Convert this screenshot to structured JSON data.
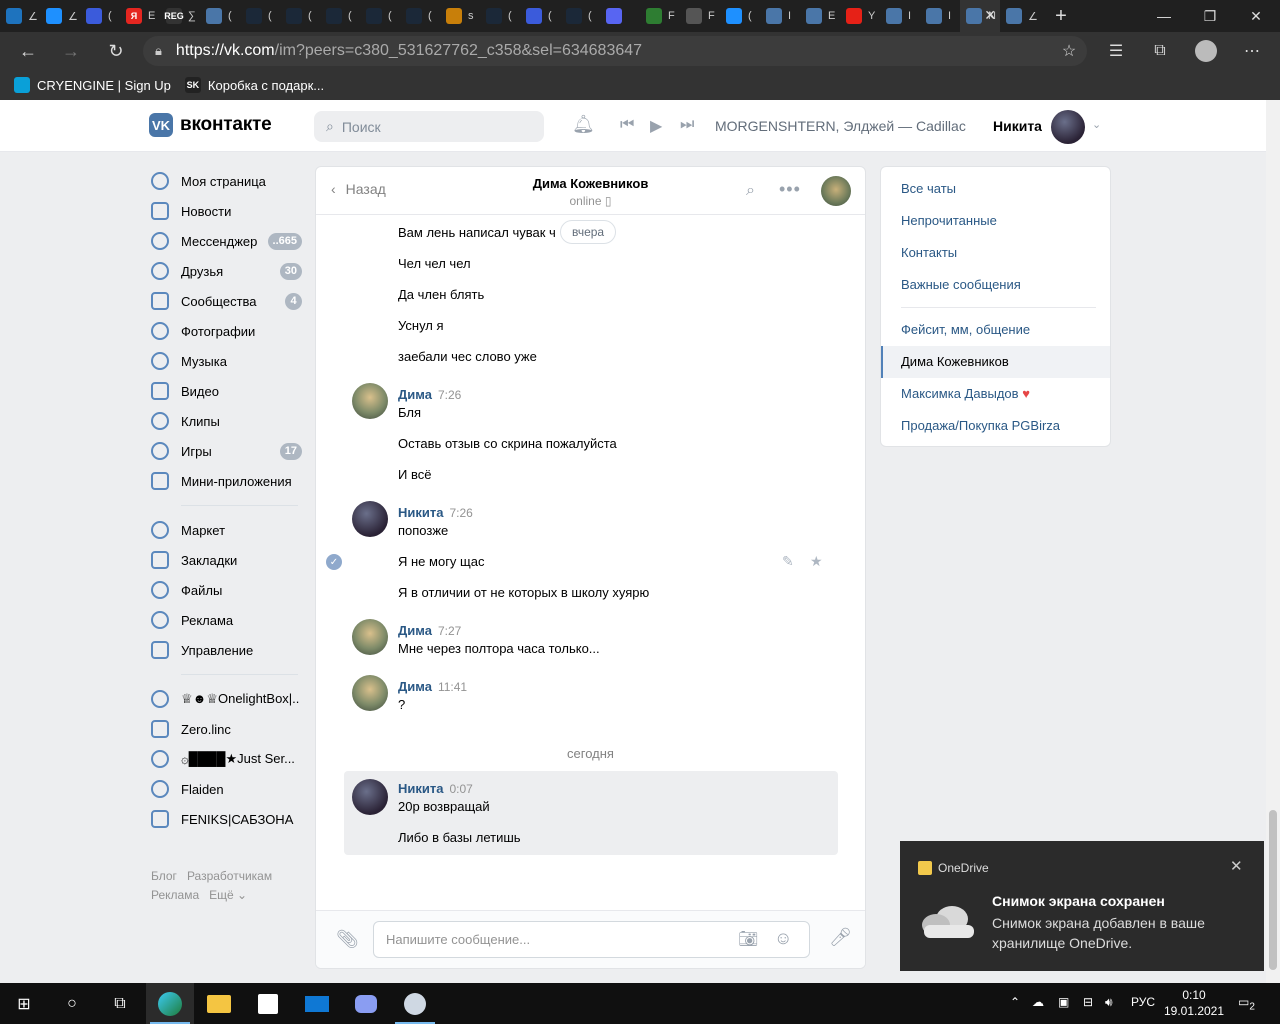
{
  "browser": {
    "tabs": [
      {
        "letter": "",
        "color": "#1e73be",
        "icon": "feather-icon"
      },
      {
        "letter": "",
        "color": "#1e90ff",
        "icon": "chat-icon"
      },
      {
        "letter": "",
        "color": "#3b5bdb",
        "icon": "hex-icon"
      },
      {
        "letter": "Я",
        "color": "#e52620",
        "icon": "yandex-icon"
      },
      {
        "letter": "REG",
        "color": "#333333",
        "icon": "reg-icon"
      },
      {
        "letter": "",
        "color": "#4a76a8",
        "icon": "vk-icon"
      },
      {
        "letter": "",
        "color": "#1b2838",
        "icon": "steam-icon"
      },
      {
        "letter": "",
        "color": "#1b2838",
        "icon": "steam-icon"
      },
      {
        "letter": "",
        "color": "#1b2838",
        "icon": "steam-icon"
      },
      {
        "letter": "",
        "color": "#1b2838",
        "icon": "steam-icon"
      },
      {
        "letter": "",
        "color": "#1b2838",
        "icon": "steam-icon"
      },
      {
        "letter": "",
        "color": "#c87f0a",
        "icon": "coin-icon"
      },
      {
        "letter": "",
        "color": "#1b2838",
        "icon": "steam-icon"
      },
      {
        "letter": "",
        "color": "#3b5bdb",
        "icon": "cat-icon"
      },
      {
        "letter": "",
        "color": "#1b2838",
        "icon": "steam-icon"
      },
      {
        "letter": "",
        "color": "#5865f2",
        "icon": "discord-icon"
      },
      {
        "letter": "",
        "color": "#2e7d32",
        "icon": "chart-icon"
      },
      {
        "letter": "",
        "color": "#555555",
        "icon": "grid-icon"
      },
      {
        "letter": "",
        "color": "#1e90ff",
        "icon": "chat-icon"
      },
      {
        "letter": "",
        "color": "#4a76a8",
        "icon": "vk-icon"
      },
      {
        "letter": "",
        "color": "#4a76a8",
        "icon": "vk-icon"
      },
      {
        "letter": "",
        "color": "#e62117",
        "icon": "youtube-icon"
      },
      {
        "letter": "",
        "color": "#4a76a8",
        "icon": "vk-icon"
      },
      {
        "letter": "",
        "color": "#4a76a8",
        "icon": "vk-icon"
      },
      {
        "letter": "",
        "color": "#4a76a8",
        "icon": "vk-icon"
      },
      {
        "letter": "",
        "color": "#4a76a8",
        "icon": "vk-icon"
      }
    ],
    "tab_titles": [
      "∠",
      "∠",
      "(",
      "E",
      "∑",
      "(",
      "(",
      "(",
      "(",
      "(",
      "(",
      "s",
      "(",
      "(",
      "(",
      "",
      "F",
      "F",
      "(",
      "I",
      "E",
      "Y",
      "I",
      "I",
      "Ν",
      "∠"
    ],
    "url_host": "https://vk.com",
    "url_path": "/im?peers=c380_531627762_c358&sel=634683647",
    "bookmarks": [
      {
        "label": "CRYENGINE | Sign Up",
        "color": "#0aa0d8",
        "icon": "cryengine-icon"
      },
      {
        "label": "Коробка с подарк...",
        "color": "#222222",
        "icon": "sk-icon",
        "letter": "SK"
      }
    ]
  },
  "vk": {
    "logo_text": "вконтакте",
    "search_placeholder": "Поиск",
    "track": "MORGENSHTERN, Элджей — Cadillac",
    "user_name": "Никита",
    "nav": [
      {
        "label": "Моя страница",
        "icon": "user-circle-icon"
      },
      {
        "label": "Новости",
        "icon": "news-icon"
      },
      {
        "label": "Мессенджер",
        "icon": "message-icon",
        "badge": "..665"
      },
      {
        "label": "Друзья",
        "icon": "friends-icon",
        "badge": "30"
      },
      {
        "label": "Сообщества",
        "icon": "groups-icon",
        "badge": "4"
      },
      {
        "label": "Фотографии",
        "icon": "photo-icon"
      },
      {
        "label": "Музыка",
        "icon": "music-icon"
      },
      {
        "label": "Видео",
        "icon": "video-icon"
      },
      {
        "label": "Клипы",
        "icon": "clips-icon"
      },
      {
        "label": "Игры",
        "icon": "games-icon",
        "badge": "17"
      },
      {
        "label": "Мини-приложения",
        "icon": "apps-icon"
      }
    ],
    "nav2": [
      {
        "label": "Маркет",
        "icon": "market-icon"
      },
      {
        "label": "Закладки",
        "icon": "star-icon"
      },
      {
        "label": "Файлы",
        "icon": "file-icon"
      },
      {
        "label": "Реклама",
        "icon": "ads-icon"
      },
      {
        "label": "Управление",
        "icon": "manage-icon"
      }
    ],
    "groups": [
      {
        "label": "♕☻♕OnelightBox|..",
        "icon": "group-icon"
      },
      {
        "label": "Zero.linc",
        "icon": "group-icon"
      },
      {
        "label": "۞████★Just Ser...",
        "icon": "group-icon"
      },
      {
        "label": "Flaiden",
        "icon": "group-icon"
      },
      {
        "label": "FENIKS|САБЗОНА",
        "icon": "group-icon"
      }
    ],
    "footer": {
      "blog": "Блог",
      "dev": "Разработчикам",
      "ads": "Реклама",
      "more": "Ещё ⌄"
    }
  },
  "chat": {
    "back_label": "Назад",
    "name": "Дима Кожевников",
    "status": "online",
    "day_pill": "вчера",
    "today": "сегодня",
    "input_placeholder": "Напишите сообщение...",
    "messages": [
      {
        "text": "Вам лень написал чувак ч"
      },
      {
        "text": "Чел чел чел"
      },
      {
        "text": "Да член блять"
      },
      {
        "text": "Уснул я"
      },
      {
        "text": "заебали чес слово уже"
      },
      {
        "author": "Дима",
        "time": "7:26",
        "text": "Бля"
      },
      {
        "text": "Оставь отзыв со скрина пожалуйста"
      },
      {
        "text": "И всё"
      },
      {
        "author": "Никита",
        "time": "7:26",
        "text": "попозже"
      },
      {
        "text": "Я не могу щас"
      },
      {
        "text": "Я в отличии от не которых в школу хуярю"
      },
      {
        "author": "Дима",
        "time": "7:27",
        "text": "Мне через полтора часа только..."
      },
      {
        "author": "Дима",
        "time": "11:41",
        "text": "?"
      },
      {
        "author": "Никита",
        "time": "0:07",
        "text": "20р возвращай"
      },
      {
        "text": "Либо в базы летишь"
      }
    ]
  },
  "right_menu": {
    "items": [
      "Все чаты",
      "Непрочитанные",
      "Контакты",
      "Важные сообщения"
    ],
    "chats": [
      "Фейсит, мм, общение",
      "Дима Кожевников",
      "Максимка Давыдов",
      "Продажа/Покупка PGBirza"
    ],
    "heart": "♥"
  },
  "toast": {
    "app": "OneDrive",
    "title": "Снимок экрана сохранен",
    "body": "Снимок экрана добавлен в ваше хранилище OneDrive."
  },
  "taskbar": {
    "lang": "РУС",
    "time": "0:10",
    "date": "19.01.2021",
    "notif_count": "2"
  }
}
